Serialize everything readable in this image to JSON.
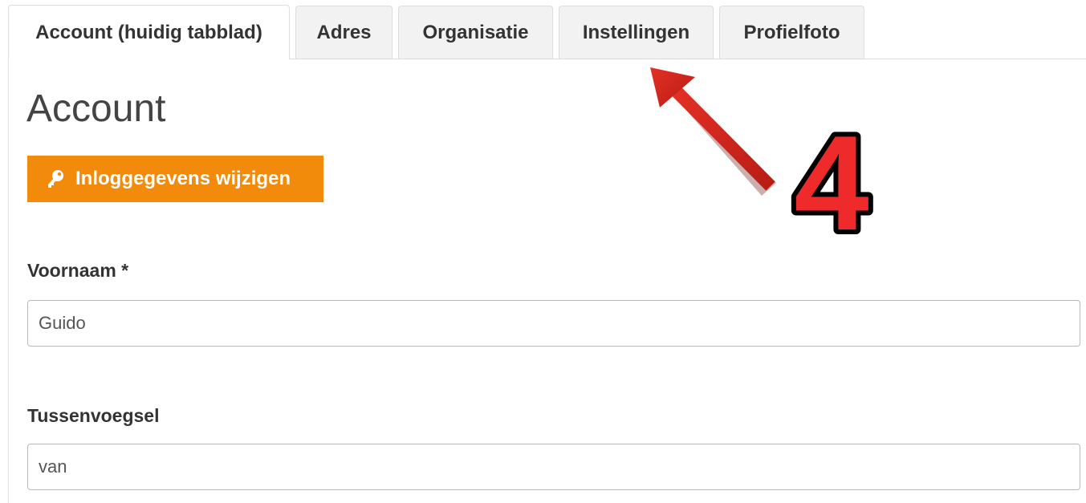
{
  "tabs": [
    {
      "label": "Account (huidig tabblad)",
      "active": true
    },
    {
      "label": "Adres",
      "active": false
    },
    {
      "label": "Organisatie",
      "active": false
    },
    {
      "label": "Instellingen",
      "active": false
    },
    {
      "label": "Profielfoto",
      "active": false
    }
  ],
  "page": {
    "title": "Account"
  },
  "actions": {
    "change_login_label": "Inloggegevens wijzigen",
    "change_login_icon": "key-icon"
  },
  "form": {
    "first_name": {
      "label": "Voornaam *",
      "value": "Guido"
    },
    "infix": {
      "label": "Tussenvoegsel",
      "value": "van"
    }
  },
  "annotation": {
    "step_number": "4",
    "arrow_color": "#d42a1f",
    "number_color": "#ee2a2a"
  },
  "colors": {
    "accent": "#f28a0c"
  }
}
